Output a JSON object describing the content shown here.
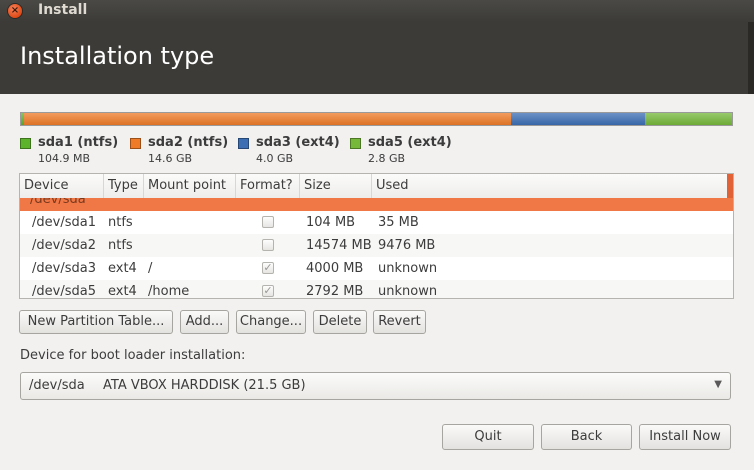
{
  "window": {
    "title": "Install"
  },
  "header": {
    "title": "Installation type"
  },
  "partitions": [
    {
      "label": "sda1 (ntfs)",
      "size": "104.9 MB",
      "color": "#5eb32d"
    },
    {
      "label": "sda2 (ntfs)",
      "size": "14.6 GB",
      "color": "#ef7b28"
    },
    {
      "label": "sda3 (ext4)",
      "size": "4.0 GB",
      "color": "#3c6eb4"
    },
    {
      "label": "sda5 (ext4)",
      "size": "2.8 GB",
      "color": "#75b83a"
    }
  ],
  "table": {
    "columns": [
      "Device",
      "Type",
      "Mount point",
      "Format?",
      "Size",
      "Used"
    ],
    "group_label": "/dev/sda",
    "rows": [
      {
        "device": "/dev/sda1",
        "type": "ntfs",
        "mount": "",
        "format": false,
        "size": "104 MB",
        "used": "35 MB"
      },
      {
        "device": "/dev/sda2",
        "type": "ntfs",
        "mount": "",
        "format": false,
        "size": "14574 MB",
        "used": "9476 MB"
      },
      {
        "device": "/dev/sda3",
        "type": "ext4",
        "mount": "/",
        "format": true,
        "size": "4000 MB",
        "used": "unknown"
      },
      {
        "device": "/dev/sda5",
        "type": "ext4",
        "mount": "/home",
        "format": true,
        "size": "2792 MB",
        "used": "unknown"
      }
    ]
  },
  "actions": {
    "new_table": "New Partition Table...",
    "add": "Add...",
    "change": "Change...",
    "delete": "Delete",
    "revert": "Revert"
  },
  "bootloader": {
    "label": "Device for boot loader installation:",
    "device": "/dev/sda",
    "name": "ATA VBOX HARDDISK (21.5 GB)"
  },
  "footer": {
    "quit": "Quit",
    "back": "Back",
    "install": "Install Now"
  },
  "colors": {
    "accent": "#dd4814",
    "header_bg": "#3c3b37"
  }
}
